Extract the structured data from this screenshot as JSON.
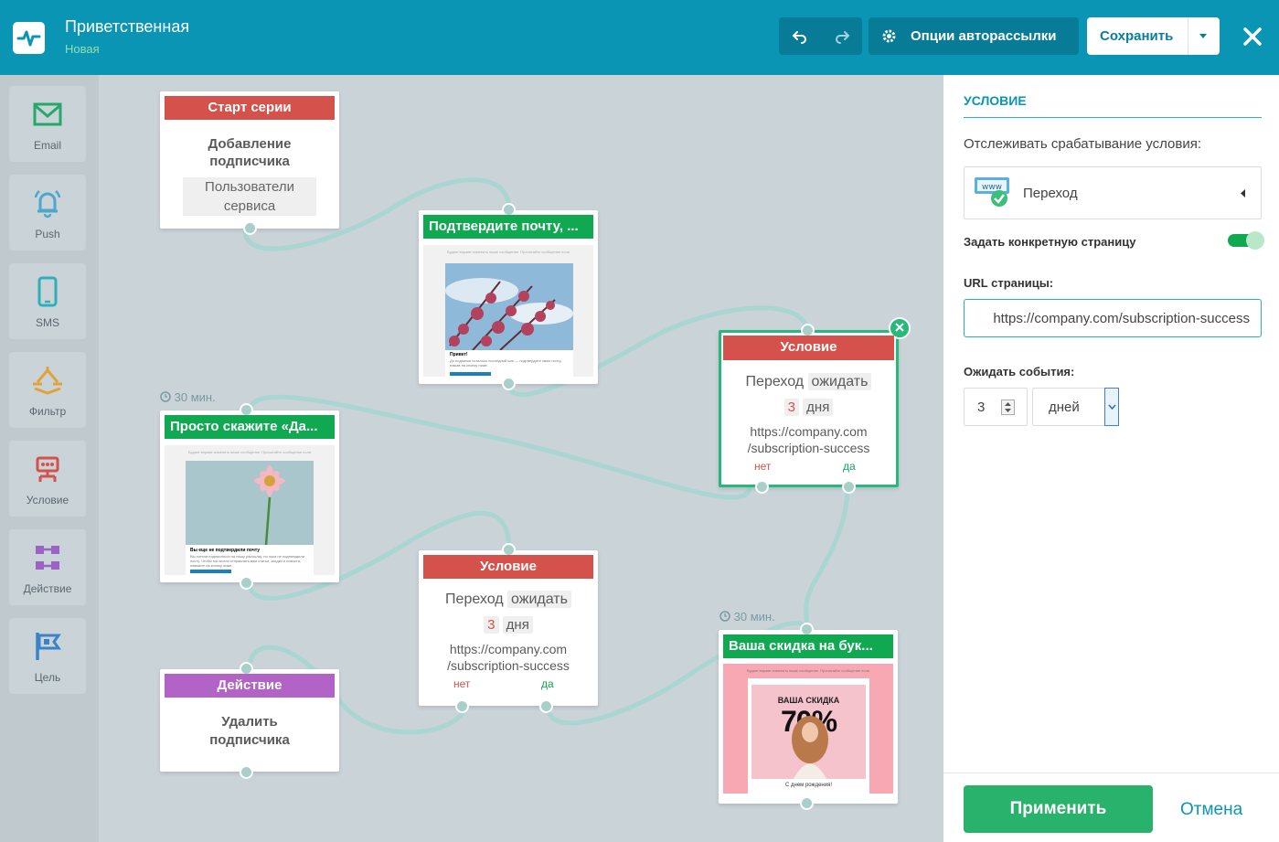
{
  "header": {
    "title": "Приветственная",
    "status": "Новая",
    "options_label": "Опции авторассылки",
    "save_label": "Сохранить"
  },
  "palette": [
    {
      "label": "Email",
      "icon": "envelope-icon"
    },
    {
      "label": "Push",
      "icon": "bell-icon"
    },
    {
      "label": "SMS",
      "icon": "phone-icon"
    },
    {
      "label": "Фильтр",
      "icon": "filter-icon"
    },
    {
      "label": "Условие",
      "icon": "condition-icon"
    },
    {
      "label": "Действие",
      "icon": "action-icon"
    },
    {
      "label": "Цель",
      "icon": "flag-icon"
    }
  ],
  "nodes": {
    "start": {
      "header": "Старт серии",
      "line1": "Добавление",
      "line2": "подписчика",
      "chip1": "Пользователи",
      "chip2": "сервиса"
    },
    "confirm": {
      "header": "Подтвердите почту, ...",
      "preview_top": "Будьте вправе изменить ваше сообщение. Прочитайте сообщение если",
      "preview_greeting": "Привет!",
      "preview_text": "До подписки осталось последний шаг — подтвердите свою почту, нажав на кнопку ниже."
    },
    "cond1": {
      "header": "Условие",
      "event": "Переход",
      "wait": "ожидать",
      "num": "3",
      "unit": "дня",
      "url1": "https://company.com",
      "url2": "/subscription-success",
      "no": "нет",
      "yes": "да"
    },
    "just": {
      "timer": "30 мин.",
      "header": "Просто скажите «Да...",
      "preview_top": "Будьте вправе изменить ваше сообщение. Прочитайте сообщение если",
      "preview_text": "Вы еще не подтвердили почту",
      "preview_sub": "Вы хотели подписаться на нашу рассылку, но пока не подтвердили почту. Чтобы мы могли отправлять вам статьи, скидки и новости, нажмите на кнопку ниже."
    },
    "cond2": {
      "header": "Условие",
      "event": "Переход",
      "wait": "ожидать",
      "num": "3",
      "unit": "дня",
      "url1": "https://company.com",
      "url2": "/subscription-success",
      "no": "нет",
      "yes": "да"
    },
    "action": {
      "header": "Действие",
      "line1": "Удалить",
      "line2": "подписчика"
    },
    "discount": {
      "timer": "30 мин.",
      "header": "Ваша скидка на бук...",
      "preview_top": "Будьте вправе изменить ваше сообщение. Прочитайте сообщение если",
      "promo1": "ВАША СКИДКА",
      "promo2": "70%",
      "footer": "С днем рождения!"
    }
  },
  "props": {
    "section": "УСЛОВИЕ",
    "track_label": "Отслеживать срабатывание условия:",
    "condition_value": "Переход",
    "specific_page_label": "Задать конкретную страницу",
    "specific_page_on": true,
    "url_label": "URL страницы:",
    "url_value": "https://company.com/subscription-success",
    "wait_label": "Ожидать события:",
    "wait_value": "3",
    "wait_unit": "дней",
    "apply_label": "Применить",
    "cancel_label": "Отмена"
  },
  "colors": {
    "topbar": "#0b95b4",
    "accent_green": "#10a850",
    "accent_red": "#d4524b",
    "accent_purple": "#b264c6",
    "link": "#a9d6d2"
  }
}
